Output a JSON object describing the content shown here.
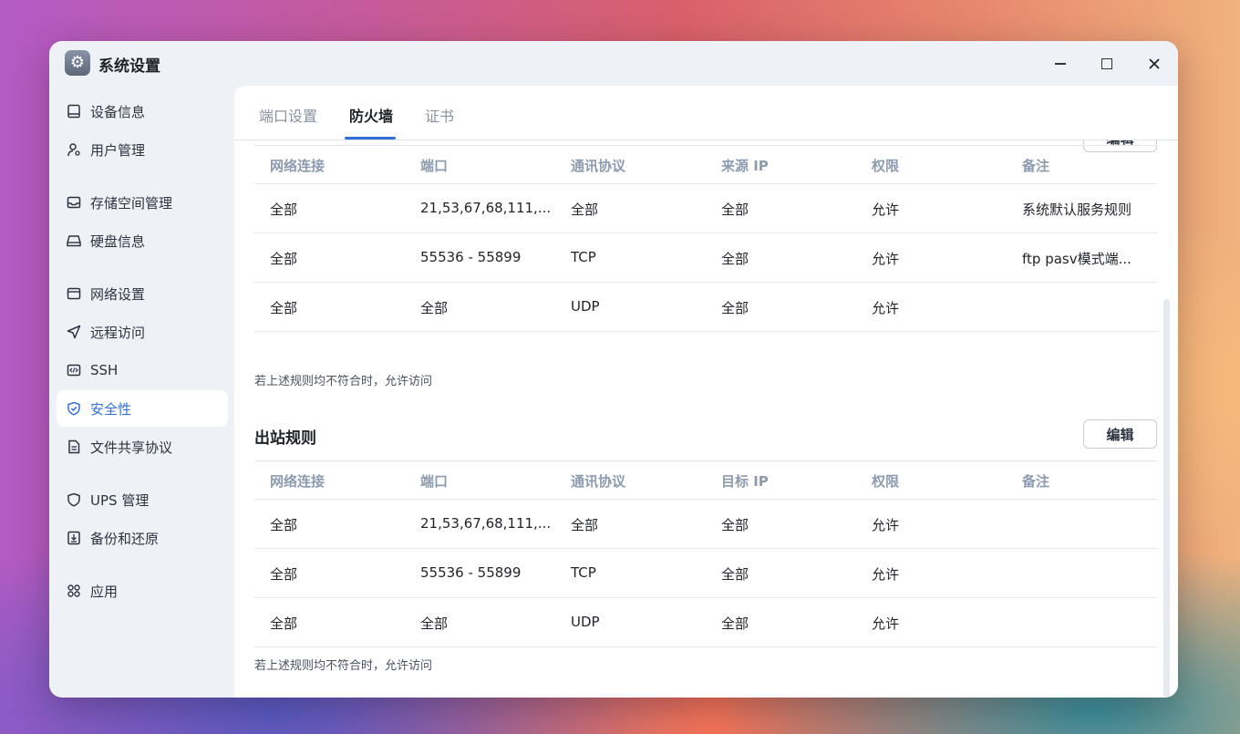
{
  "window": {
    "title": "系统设置",
    "controls": {
      "minimize": "minimize",
      "maximize": "maximize",
      "close": "close"
    }
  },
  "sidebar": {
    "items": [
      {
        "label": "设备信息",
        "icon": "device-icon"
      },
      {
        "label": "用户管理",
        "icon": "user-icon"
      },
      {
        "label": "存储空间管理",
        "icon": "storage-icon"
      },
      {
        "label": "硬盘信息",
        "icon": "disk-icon"
      },
      {
        "label": "网络设置",
        "icon": "network-icon"
      },
      {
        "label": "远程访问",
        "icon": "send-icon"
      },
      {
        "label": "SSH",
        "icon": "code-icon"
      },
      {
        "label": "安全性",
        "icon": "shield-icon",
        "active": true
      },
      {
        "label": "文件共享协议",
        "icon": "file-icon"
      },
      {
        "label": "UPS 管理",
        "icon": "ups-shield-icon"
      },
      {
        "label": "备份和还原",
        "icon": "backup-icon"
      },
      {
        "label": "应用",
        "icon": "apps-icon"
      }
    ]
  },
  "tabs": [
    {
      "label": "端口设置"
    },
    {
      "label": "防火墙",
      "active": true
    },
    {
      "label": "证书"
    }
  ],
  "inbound": {
    "edit_label": "编辑",
    "headers": [
      "网络连接",
      "端口",
      "通讯协议",
      "来源 IP",
      "权限",
      "备注"
    ],
    "rows": [
      [
        "全部",
        "21,53,67,68,111,...",
        "全部",
        "全部",
        "允许",
        "系统默认服务规则"
      ],
      [
        "全部",
        "55536 - 55899",
        "TCP",
        "全部",
        "允许",
        "ftp pasv模式端..."
      ],
      [
        "全部",
        "全部",
        "UDP",
        "全部",
        "允许",
        ""
      ]
    ],
    "footer_note": "若上述规则均不符合时，允许访问"
  },
  "outbound": {
    "title": "出站规则",
    "edit_label": "编辑",
    "headers": [
      "网络连接",
      "端口",
      "通讯协议",
      "目标 IP",
      "权限",
      "备注"
    ],
    "rows": [
      [
        "全部",
        "21,53,67,68,111,...",
        "全部",
        "全部",
        "允许",
        ""
      ],
      [
        "全部",
        "55536 - 55899",
        "TCP",
        "全部",
        "允许",
        ""
      ],
      [
        "全部",
        "全部",
        "UDP",
        "全部",
        "允许",
        ""
      ]
    ],
    "footer_note": "若上述规则均不符合时，允许访问"
  },
  "colors": {
    "accent": "#2f6fd6",
    "header_text": "#8d9bb0",
    "sidebar_bg": "#eef2f7"
  }
}
